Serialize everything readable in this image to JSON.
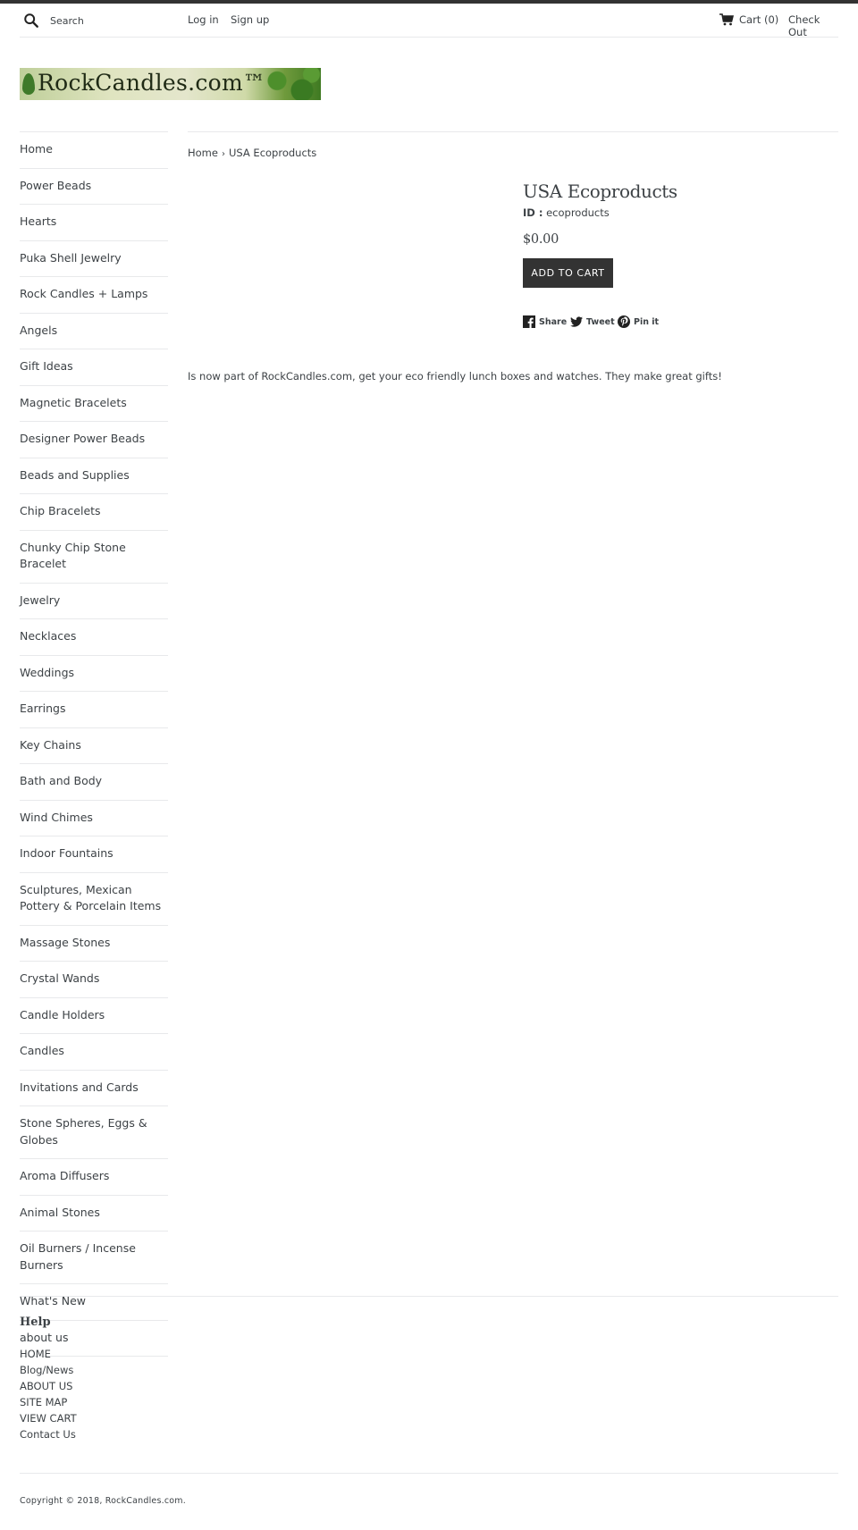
{
  "header": {
    "search_placeholder": "Search",
    "login_label": "Log in",
    "signup_label": "Sign up",
    "cart_label": "Cart (0)",
    "checkout_label": "Check Out"
  },
  "logo": {
    "text": "RockCandles.com™"
  },
  "sidebar": {
    "items": [
      {
        "label": "Home"
      },
      {
        "label": "Power Beads"
      },
      {
        "label": "Hearts"
      },
      {
        "label": "Puka Shell Jewelry"
      },
      {
        "label": "Rock Candles + Lamps"
      },
      {
        "label": "Angels"
      },
      {
        "label": "Gift Ideas"
      },
      {
        "label": "Magnetic Bracelets"
      },
      {
        "label": "Designer Power Beads"
      },
      {
        "label": "Beads and Supplies"
      },
      {
        "label": "Chip Bracelets"
      },
      {
        "label": "Chunky Chip Stone Bracelet"
      },
      {
        "label": "Jewelry"
      },
      {
        "label": "Necklaces"
      },
      {
        "label": "Weddings"
      },
      {
        "label": "Earrings"
      },
      {
        "label": "Key Chains"
      },
      {
        "label": "Bath and Body"
      },
      {
        "label": "Wind Chimes"
      },
      {
        "label": "Indoor Fountains"
      },
      {
        "label": "Sculptures, Mexican Pottery & Porcelain Items"
      },
      {
        "label": "Massage Stones"
      },
      {
        "label": "Crystal Wands"
      },
      {
        "label": "Candle Holders"
      },
      {
        "label": "Candles"
      },
      {
        "label": "Invitations and Cards"
      },
      {
        "label": "Stone Spheres, Eggs & Globes"
      },
      {
        "label": "Aroma Diffusers"
      },
      {
        "label": "Animal Stones"
      },
      {
        "label": "Oil Burners / Incense Burners"
      },
      {
        "label": "What's New"
      },
      {
        "label": "about us"
      }
    ]
  },
  "breadcrumb": {
    "home": "Home",
    "separator": "›",
    "current": "USA Ecoproducts"
  },
  "product": {
    "title": "USA Ecoproducts",
    "id_label": "ID :",
    "id_value": "ecoproducts",
    "price": "$0.00",
    "add_to_cart": "ADD TO CART",
    "share": {
      "facebook": "Share",
      "twitter": "Tweet",
      "pinterest": "Pin it"
    },
    "description": "Is now part of RockCandles.com, get your eco friendly lunch boxes and watches. They make great gifts!"
  },
  "footer": {
    "help_title": "Help",
    "links": [
      {
        "label": "HOME"
      },
      {
        "label": "Blog/News"
      },
      {
        "label": "ABOUT US"
      },
      {
        "label": "SITE MAP"
      },
      {
        "label": "VIEW CART"
      },
      {
        "label": "Contact Us"
      }
    ],
    "copyright": "Copyright © 2018, RockCandles.com."
  }
}
